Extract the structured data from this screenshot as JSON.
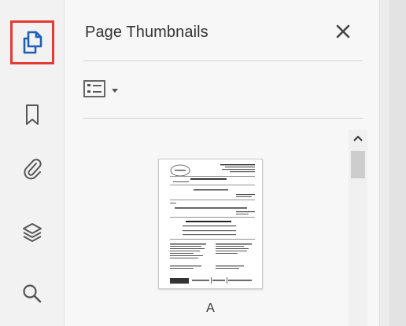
{
  "panel": {
    "title": "Page Thumbnails",
    "close_icon": "close-icon",
    "options_icon": "list-options-icon"
  },
  "toolbar": {
    "items": [
      {
        "name": "page-thumbnails",
        "icon": "pages-icon",
        "selected": true
      },
      {
        "name": "bookmarks",
        "icon": "bookmark-icon",
        "selected": false
      },
      {
        "name": "attachments",
        "icon": "paperclip-icon",
        "selected": false
      },
      {
        "name": "layers",
        "icon": "layers-icon",
        "selected": false
      },
      {
        "name": "search",
        "icon": "search-icon",
        "selected": false
      }
    ]
  },
  "thumbnails": [
    {
      "label": "A"
    }
  ],
  "colors": {
    "accent_blue": "#1e5fb8",
    "highlight_red": "#e53935",
    "panel_bg": "#f7f7f7",
    "rail_bg": "#f2f2f2"
  }
}
